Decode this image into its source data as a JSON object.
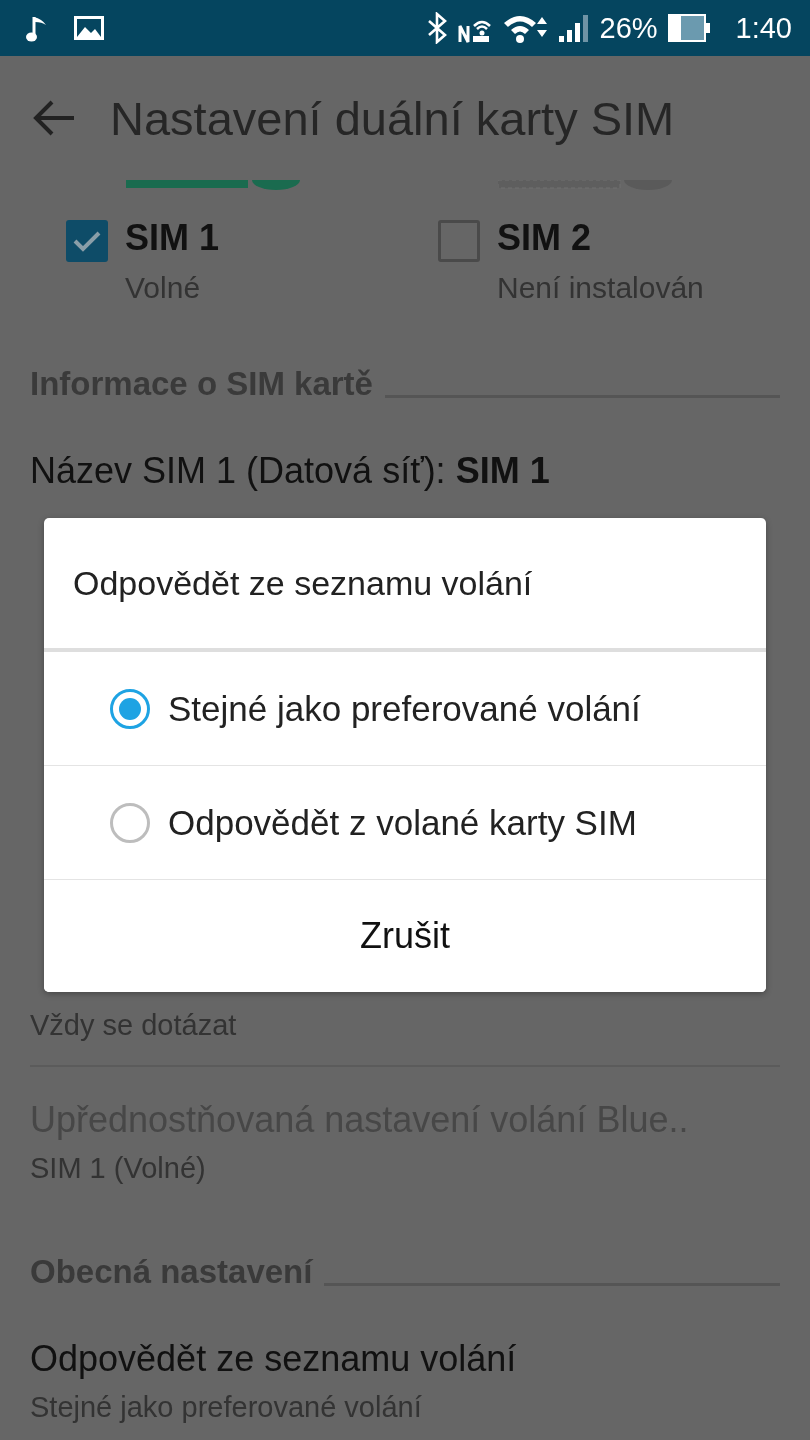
{
  "status_bar": {
    "battery_text": "26%",
    "time": "1:40"
  },
  "app_bar": {
    "title": "Nastavení duální karty SIM"
  },
  "sims": [
    {
      "label": "SIM 1",
      "status": "Volné",
      "checked": true
    },
    {
      "label": "SIM 2",
      "status": "Není instalován",
      "checked": false
    }
  ],
  "rows": [
    {
      "kind": "header",
      "text": "Informace o SIM kartě"
    },
    {
      "kind": "item",
      "title": "Název SIM 1 (Datová síť): **SIM 1**",
      "disabled": false
    },
    {
      "kind": "covered"
    },
    {
      "kind": "item",
      "summary": [
        "Vždy se dotázat"
      ]
    },
    {
      "kind": "item",
      "title": "Upřednostňovaná nastavení volání Blue..",
      "disabled": true,
      "summary": [
        "SIM 1 (Volné)"
      ]
    },
    {
      "kind": "header",
      "text": "Obecná nastavení"
    },
    {
      "kind": "item",
      "title": "Odpovědět ze seznamu volání",
      "disabled": false,
      "summary": [
        "Stejné jako preferované volání"
      ]
    }
  ],
  "dialog": {
    "title": "Odpovědět ze seznamu volání",
    "options": [
      {
        "label": "Stejné jako preferované volání",
        "selected": true
      },
      {
        "label": "Odpovědět z volané karty SIM",
        "selected": false
      }
    ],
    "button": "Zrušit"
  }
}
